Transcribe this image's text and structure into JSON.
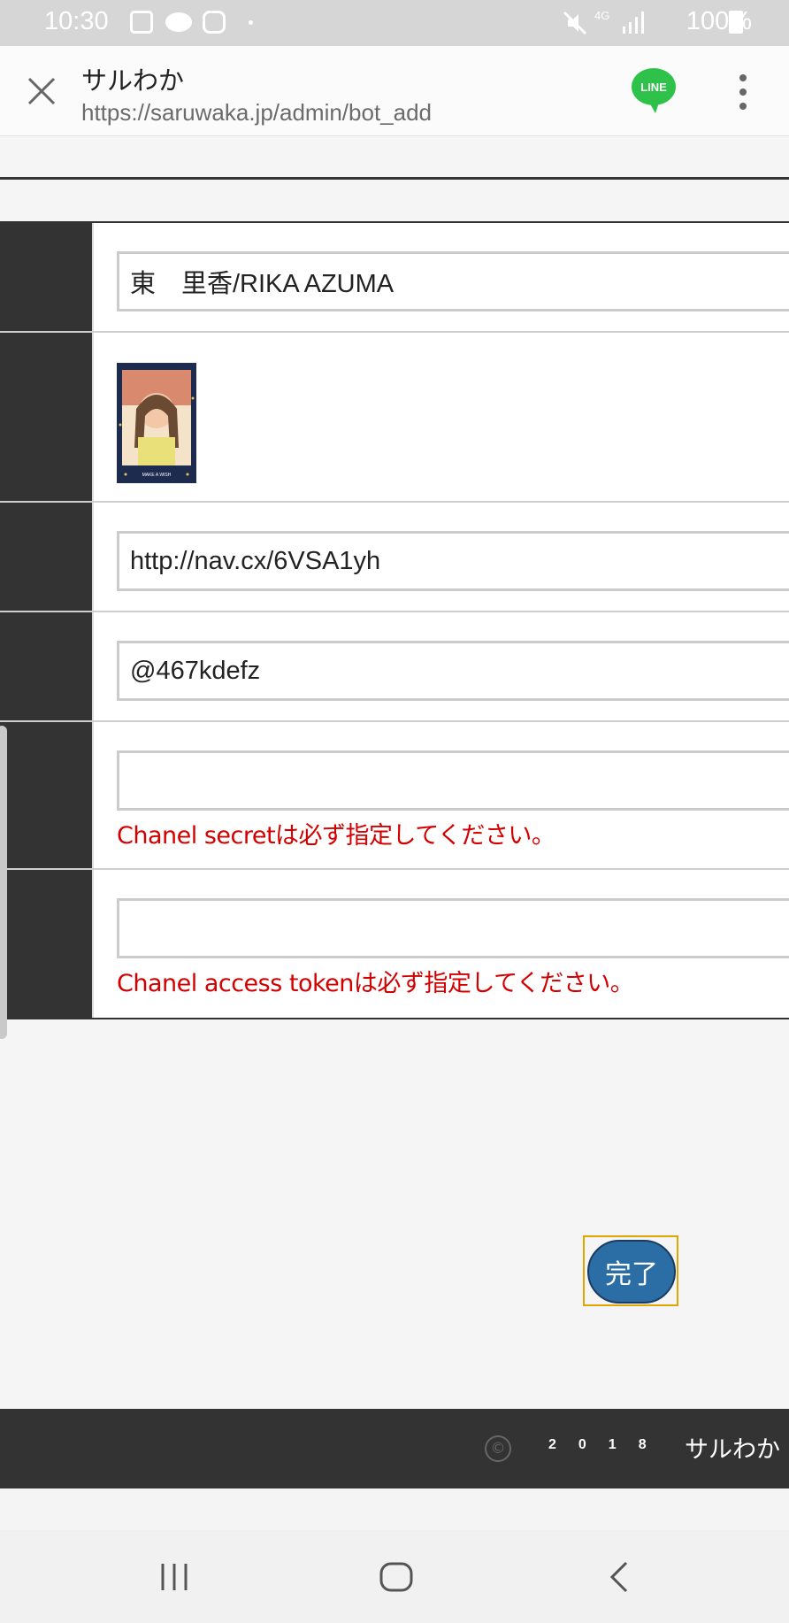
{
  "status_bar": {
    "time": "10:30",
    "battery": "100%",
    "icons": [
      "flag-icon",
      "cloud-icon",
      "instagram-icon",
      "dot-icon",
      "mute-icon",
      "4g-icon",
      "signal-icon",
      "battery-icon"
    ]
  },
  "browser": {
    "title": "サルわか",
    "url": "https://saruwaka.jp/admin/bot_add",
    "line_badge": "LINE"
  },
  "form": {
    "name_value": "東　里香/RIKA AZUMA",
    "image_caption": "MAKE A WISH",
    "url_value": "http://nav.cx/6VSA1yh",
    "line_id_value": "@467kdefz",
    "channel_secret_value": "",
    "channel_secret_error": "Chanel secretは必ず指定してください。",
    "access_token_value": "",
    "access_token_error": "Chanel access tokenは必ず指定してください。"
  },
  "submit_label": "完了",
  "footer": {
    "copyright_symbol": "©",
    "year": "2018",
    "brand": "サルわか"
  },
  "colors": {
    "error": "#d40000",
    "button": "#2b6ea5",
    "dark": "#333333",
    "line_green": "#2fc24b"
  }
}
